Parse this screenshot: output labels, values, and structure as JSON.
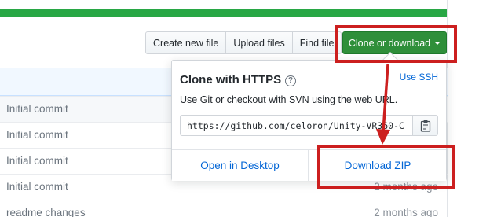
{
  "toolbar": {
    "create_new_file": "Create new file",
    "upload_files": "Upload files",
    "find_file": "Find file",
    "clone_or_download": "Clone or download"
  },
  "clone_popover": {
    "title": "Clone with HTTPS",
    "use_ssh": "Use SSH",
    "description": "Use Git or checkout with SVN using the web URL.",
    "url": "https://github.com/celoron/Unity-VR360-C",
    "open_in_desktop": "Open in Desktop",
    "download_zip": "Download ZIP"
  },
  "files": [
    {
      "commit": "Initial commit",
      "age": ""
    },
    {
      "commit": "Initial commit",
      "age": ""
    },
    {
      "commit": "Initial commit",
      "age": ""
    },
    {
      "commit": "Initial commit",
      "age": "2 months ago"
    },
    {
      "commit": "readme changes",
      "age": "2 months ago"
    }
  ],
  "colors": {
    "progress_green": "#28a745",
    "clone_button": "#2f8f3a",
    "annotation_red": "#cc1f1f",
    "link_blue": "#0366d6"
  },
  "icons": {
    "help": "question-circle-icon",
    "copy": "clipboard-icon",
    "caret": "caret-down-icon"
  }
}
